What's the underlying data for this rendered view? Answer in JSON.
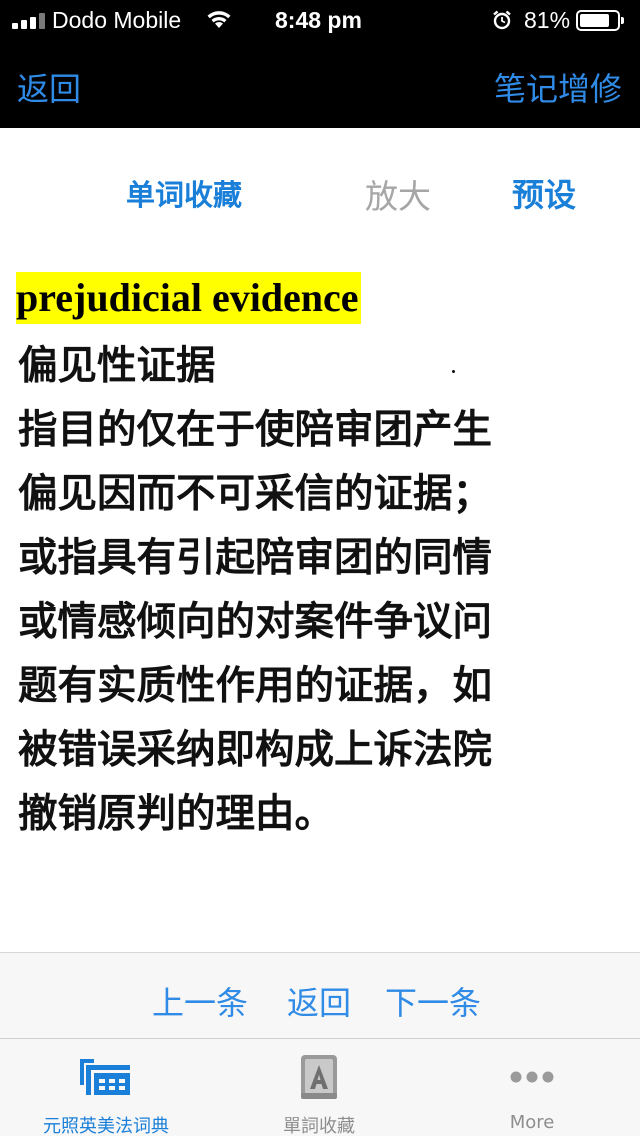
{
  "status_bar": {
    "carrier": "Dodo Mobile",
    "time": "8:48 pm",
    "battery_percent": "81%",
    "battery_level": 0.81,
    "signal_bars": 3,
    "icons": [
      "signal-icon",
      "wifi-icon",
      "alarm-icon",
      "battery-icon"
    ]
  },
  "nav": {
    "back_label": "返回",
    "right_label": "笔记增修"
  },
  "toolbar": {
    "favorite_label": "单词收藏",
    "zoom_label": "放大",
    "preset_label": "预设"
  },
  "entry": {
    "headword": "prejudicial evidence",
    "lines": [
      "偏见性证据",
      "指目的仅在于使陪审团产生",
      "偏见因而不可采信的证据；",
      "或指具有引起陪审团的同情",
      "或情感倾向的对案件争议问",
      "题有实质性作用的证据，如",
      "被错误采纳即构成上诉法院",
      "撤销原判的理由。"
    ]
  },
  "pager": {
    "prev_label": "上一条",
    "back_label": "返回",
    "next_label": "下一条"
  },
  "tabbar": {
    "tabs": [
      {
        "label": "元照英美法词典",
        "icon": "dictionary-icon",
        "selected": true
      },
      {
        "label": "單詞收藏",
        "icon": "bookmark-library-icon",
        "selected": false
      },
      {
        "label": "More",
        "icon": "more-icon",
        "selected": false
      }
    ]
  },
  "colors": {
    "accent": "#2f8be6",
    "highlight": "#ffff00",
    "disabled": "#a6a6a6"
  }
}
